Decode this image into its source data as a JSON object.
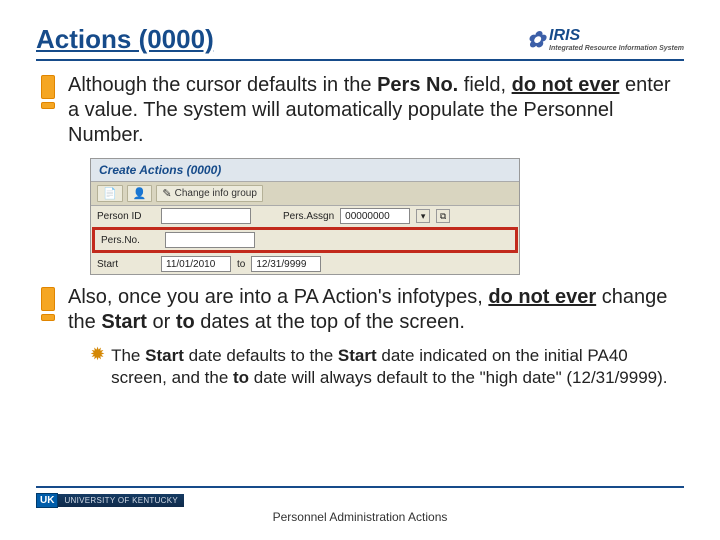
{
  "header": {
    "title": "Actions (0000)",
    "logo": {
      "text": "IRIS",
      "tagline": "Integrated Resource Information System"
    }
  },
  "para1": {
    "p1": "Although the cursor defaults in the ",
    "persno": "Pers No.",
    "p2": " field, ",
    "donot": "do not ever",
    "p3": " enter a value.  The system will automatically populate the Personnel Number."
  },
  "shot": {
    "title": "Create Actions (0000)",
    "toolbar": {
      "btn1": "",
      "btn2": "",
      "change": "Change info group"
    },
    "rows": {
      "personId": {
        "label": "Person ID",
        "value": "",
        "persAssgnLabel": "Pers.Assgn",
        "persAssgnValue": "00000000"
      },
      "persNo": {
        "label": "Pers.No.",
        "value": ""
      },
      "dates": {
        "startLabel": "Start",
        "startValue": "11/01/2010",
        "toLabel": "to",
        "toValue": "12/31/9999"
      }
    }
  },
  "para2": {
    "p1": "Also, once you are into a PA Action's infotypes, ",
    "donot": "do not ever",
    "p2": " change the ",
    "start": "Start",
    "p3": " or ",
    "to": "to",
    "p4": " dates at the top of the screen."
  },
  "sub": {
    "s1": "The ",
    "start1": "Start",
    "s2": " date defaults to the ",
    "start2": "Start",
    "s3": " date indicated on the initial PA40 screen, and the ",
    "to": "to",
    "s4": " date will always default to the \"high date\" (12/31/9999)."
  },
  "footer": {
    "uk1": "UK",
    "uk2": "UNIVERSITY OF KENTUCKY",
    "caption": "Personnel Administration Actions"
  }
}
